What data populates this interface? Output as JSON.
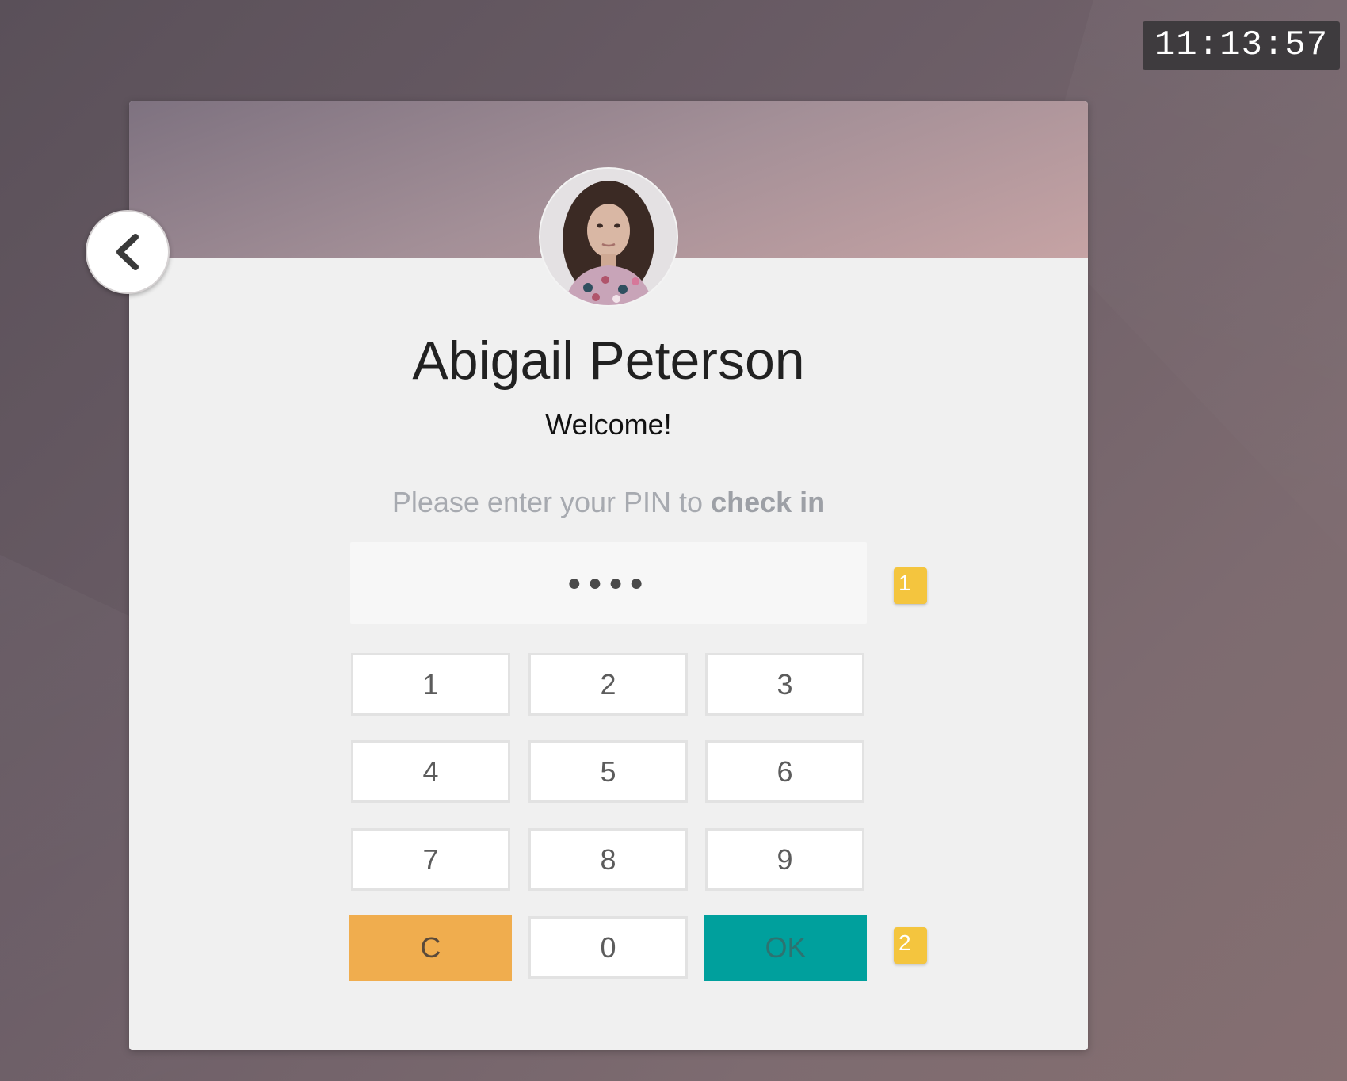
{
  "clock": {
    "time": "11:13:57"
  },
  "employee": {
    "name": "Abigail Peterson",
    "greeting": "Welcome!"
  },
  "instruction": {
    "prefix": "Please enter your PIN to ",
    "action": "check in"
  },
  "pin": {
    "masked_value": "●●●●"
  },
  "keypad": {
    "keys": [
      "1",
      "2",
      "3",
      "4",
      "5",
      "6",
      "7",
      "8",
      "9"
    ],
    "clear_label": "C",
    "zero_label": "0",
    "ok_label": "OK"
  },
  "markers": [
    "1",
    "2"
  ],
  "colors": {
    "clear": "#f0ad4e",
    "ok": "#00a09d",
    "marker": "#f4c53e"
  },
  "icons": {
    "back": "chevron-left-icon",
    "avatar": "user-photo"
  }
}
